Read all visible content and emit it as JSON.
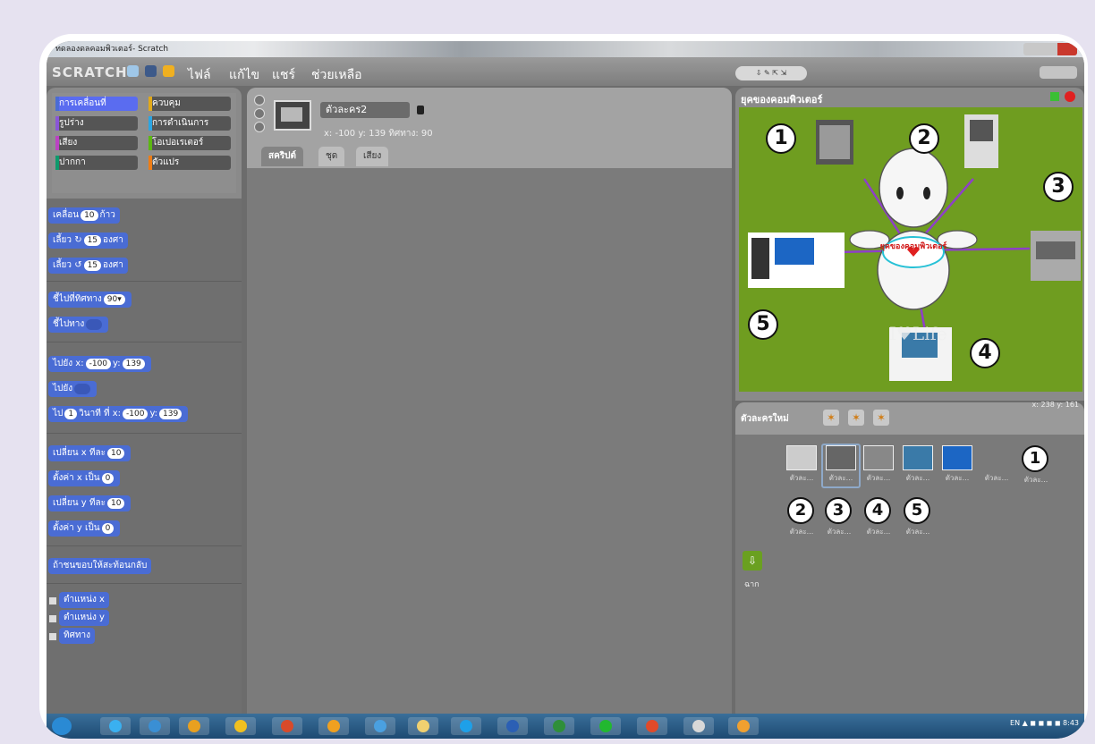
{
  "window": {
    "title": "ทดลองดลคอมพิวเตอร์- Scratch"
  },
  "menu": {
    "logo": "SCRATCH",
    "items": [
      "ไฟล์",
      "แก้ไข",
      "แชร์",
      "ช่วยเหลือ"
    ]
  },
  "categories": [
    {
      "label": "การเคลื่อนที่",
      "color": "#4a6cd4"
    },
    {
      "label": "ควบคุม",
      "color": "#e1a91a"
    },
    {
      "label": "รูปร่าง",
      "color": "#8a55d7"
    },
    {
      "label": "การดำเนินการ",
      "color": "#e1a91a"
    },
    {
      "label": "เสียง",
      "color": "#bb42c3"
    },
    {
      "label": "โอเปอเรเตอร์",
      "color": "#5cb712"
    },
    {
      "label": "ปากกา",
      "color": "#0e9a6c"
    },
    {
      "label": "ตัวแปร",
      "color": "#ee7d16"
    }
  ],
  "blocks": {
    "move": {
      "pre": "เคลื่อน",
      "v": "10",
      "post": "ก้าว"
    },
    "turn_cw": {
      "pre": "เลี้ยว ↻",
      "v": "15",
      "post": "องศา"
    },
    "turn_ccw": {
      "pre": "เลี้ยว ↺",
      "v": "15",
      "post": "องศา"
    },
    "point_dir": {
      "pre": "ชี้ไปที่ทิศทาง",
      "v": "90▾"
    },
    "point_to": {
      "pre": "ชี้ไปทาง"
    },
    "goto_xy": {
      "pre": "ไปยัง x:",
      "x": "-100",
      "mid": "y:",
      "y": "139"
    },
    "goto": {
      "pre": "ไปยัง"
    },
    "glide": {
      "pre": "ไป",
      "s": "1",
      "mid1": "วินาที ที่ x:",
      "x": "-100",
      "mid2": "y:",
      "y": "139"
    },
    "change_x": {
      "pre": "เปลี่ยน x ทีละ",
      "v": "10"
    },
    "set_x": {
      "pre": "ตั้งค่า x เป็น",
      "v": "0"
    },
    "change_y": {
      "pre": "เปลี่ยน y ทีละ",
      "v": "10"
    },
    "set_y": {
      "pre": "ตั้งค่า y เป็น",
      "v": "0"
    },
    "bounce": {
      "label": "ถ้าชนขอบให้สะท้อนกลับ"
    },
    "xpos": {
      "label": "ตำแหน่ง x"
    },
    "ypos": {
      "label": "ตำแหน่ง y"
    },
    "dir": {
      "label": "ทิศทาง"
    }
  },
  "sprite": {
    "name": "ตัวละคร2",
    "coords": "x: -100  y: 139   ทิศทาง: 90"
  },
  "tabs": [
    "สคริปต์",
    "ชุด",
    "เสียง"
  ],
  "stage": {
    "title": "ยุคของคอมพิวเตอร์",
    "center_text": "ยุคของคอมพิวเตอร์",
    "watermark": "I♥Life",
    "numbers": [
      "1",
      "2",
      "3",
      "4",
      "5"
    ]
  },
  "sprites_panel": {
    "new_sprite": "ตัวละครใหม่",
    "mouse": "x: 238   y: 161",
    "thumb_label": "ตัวละ...",
    "stage_label": "ฉาก",
    "numbers": [
      "1",
      "2",
      "3",
      "4",
      "5"
    ]
  },
  "taskbar": {
    "tray": "EN ▲ ◼ ◼ ◼ ◼   8:43"
  }
}
